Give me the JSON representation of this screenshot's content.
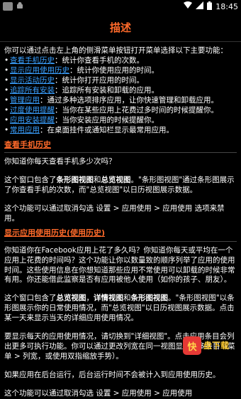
{
  "status": {
    "time": "18:45"
  },
  "header": {
    "title": "描述"
  },
  "intro": "你可以通过点击左上角的侧滑菜单按钮打开菜单选择以下主要功能：",
  "features": [
    {
      "link": "查看手机历史",
      "desc": "：统计你查看手机的次数。"
    },
    {
      "link": "显示应用使用历史",
      "desc": "：统计你使用应用的时间。"
    },
    {
      "link": "显示活动历史",
      "desc": "：统计你打开应用的时间。"
    },
    {
      "link": "追踪所有安装",
      "desc": "：追踪所有安装和卸载的应用。"
    },
    {
      "link": "管理应用",
      "desc": "：通过多种选项排序应用，让你快速管理和卸载应用。"
    },
    {
      "link": "过度使用提醒",
      "desc": "：当你在某些应用上花费过多时间的时候提醒你。"
    },
    {
      "link": "应用安装提醒",
      "desc": "：当你安装应用的时候提醒你。"
    },
    {
      "link": "常用应用",
      "desc": "：在桌面挂件或通知栏显示最常用应用。"
    }
  ],
  "section1": {
    "heading": "查看手机历史",
    "q": "你知道你每天查看手机多少次吗？",
    "p1_a": "这个窗口包含了",
    "p1_b1": "条形图视图",
    "p1_and": "和",
    "p1_b2": "总览视图",
    "p1_c": "。\"条形图视图\"通过条形图展示了你查看手机的次数，而\"总览视图\"以日历视图展示数据。",
    "p2": "这个功能可以通过取消勾选 设置 > 应用使用 > 应用使用 选项来禁用。"
  },
  "section2": {
    "heading": "显示应用使用历史(使用历史)",
    "p1": "你知道你在Facebook应用上花了多久吗？你知道你每天或平均在一个应用上花费的时间吗？这个功能让你以数量致的顺序列举了应用的使用时间。这些使用信息在你想知道那些应用不常使用可以卸载的时候非常有用。你还能借此监察是否有应用被他人使用（如你的孩子、朋友）。",
    "p2_a": "这个窗口包含了",
    "p2_b1": "总览视图",
    "p2_sep1": "，",
    "p2_b2": "详情视图",
    "p2_and": "和",
    "p2_b3": "条形图视图",
    "p2_c": "。\"条形图视图\"以条形图展示你的日常使用情况，而\"总览视图\"以日历视图展示数据。点击某一天来显示当天的详细应用使用情况。",
    "p3": "要显示每天的应用使用情况，请切换到\"详细视图\"。点击应用条目会列出更多可执行功能。你可以通过更改列宽在同一视图显示更多条目（菜单 > 列宽，或使用双指缩放手势）。",
    "p4": "如果应用在后台运行，后台运行时间不会被计入到应用使用历史。",
    "p5": "这个功能可以通过取消勾选 设置 > 应用使用 > 应用使用"
  },
  "watermark": {
    "badge": "快",
    "text": "盘下载"
  }
}
